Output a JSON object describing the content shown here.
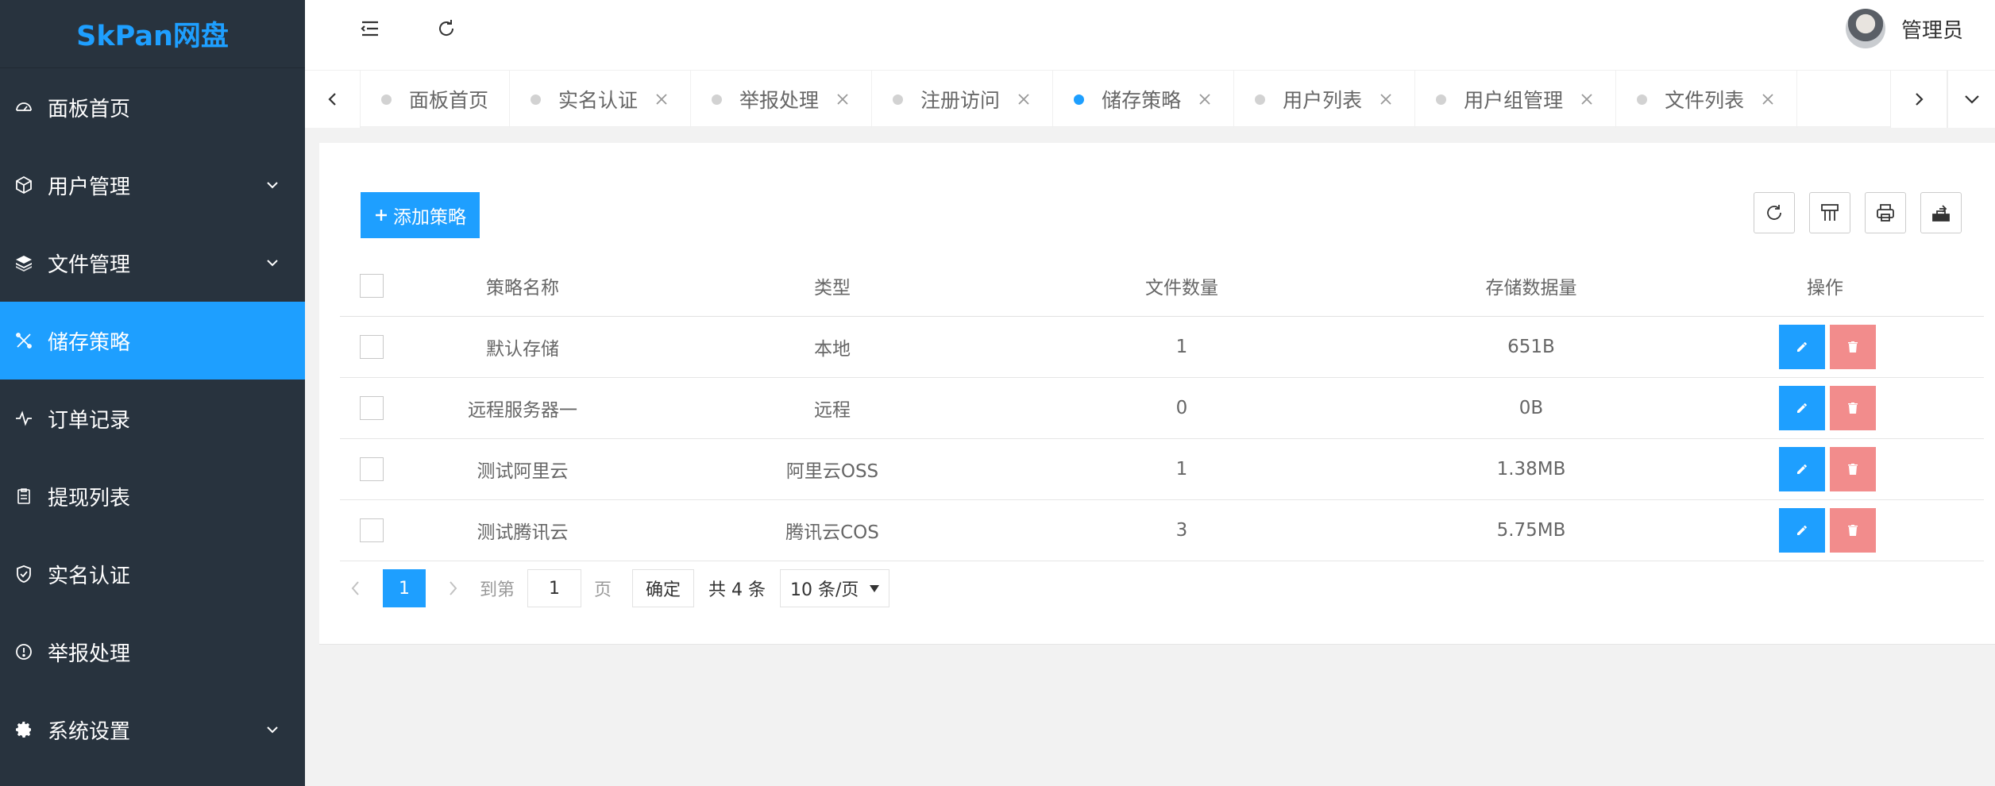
{
  "app": {
    "logo": "SkPan网盘"
  },
  "sidebar": {
    "items": [
      {
        "label": "面板首页",
        "icon": "dashboard-icon",
        "has_arrow": false
      },
      {
        "label": "用户管理",
        "icon": "cube-icon",
        "has_arrow": true
      },
      {
        "label": "文件管理",
        "icon": "layers-icon",
        "has_arrow": true
      },
      {
        "label": "储存策略",
        "icon": "tools-icon",
        "has_arrow": false,
        "active": true
      },
      {
        "label": "订单记录",
        "icon": "pulse-icon",
        "has_arrow": false
      },
      {
        "label": "提现列表",
        "icon": "clipboard-icon",
        "has_arrow": false
      },
      {
        "label": "实名认证",
        "icon": "shield-check-icon",
        "has_arrow": false
      },
      {
        "label": "举报处理",
        "icon": "info-circle-icon",
        "has_arrow": false
      },
      {
        "label": "系统设置",
        "icon": "gear-icon",
        "has_arrow": true
      }
    ]
  },
  "header": {
    "user_name": "管理员"
  },
  "tabs": [
    {
      "label": "面板首页",
      "closable": false
    },
    {
      "label": "实名认证",
      "closable": true
    },
    {
      "label": "举报处理",
      "closable": true
    },
    {
      "label": "注册访问",
      "closable": true
    },
    {
      "label": "储存策略",
      "closable": true,
      "active": true
    },
    {
      "label": "用户列表",
      "closable": true
    },
    {
      "label": "用户组管理",
      "closable": true
    },
    {
      "label": "文件列表",
      "closable": true
    }
  ],
  "toolbar": {
    "add_label": "添加策略"
  },
  "table": {
    "columns": [
      "策略名称",
      "类型",
      "文件数量",
      "存储数据量",
      "操作"
    ],
    "rows": [
      {
        "name": "默认存储",
        "type": "本地",
        "count": "1",
        "size": "651B"
      },
      {
        "name": "远程服务器一",
        "type": "远程",
        "count": "0",
        "size": "0B"
      },
      {
        "name": "测试阿里云",
        "type": "阿里云OSS",
        "count": "1",
        "size": "1.38MB"
      },
      {
        "name": "测试腾讯云",
        "type": "腾讯云COS",
        "count": "3",
        "size": "5.75MB"
      }
    ]
  },
  "pagination": {
    "current_page": "1",
    "goto_label": "到第",
    "goto_value": "1",
    "page_label": "页",
    "confirm_label": "确定",
    "total_label": "共 4 条",
    "page_size": "10 条/页"
  },
  "colors": {
    "accent": "#1e9fff",
    "sidebar_bg": "#28333e",
    "danger": "#f07070"
  }
}
